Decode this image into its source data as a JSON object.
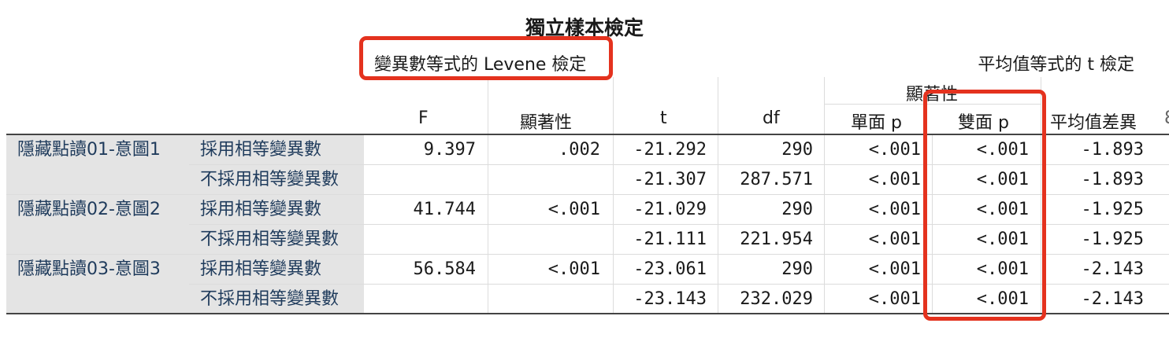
{
  "title": "獨立樣本檢定",
  "levene_header": "變異數等式的 Levene 檢定",
  "ttest_header": "平均值等式的 t 檢定",
  "significance_group": "顯著性",
  "columns": {
    "F": "F",
    "sig": "顯著性",
    "t": "t",
    "df": "df",
    "one_sided_p": "單面 p",
    "two_sided_p": "雙面 p",
    "mean_diff": "平均值差異",
    "cut": "8"
  },
  "groups": [
    {
      "name": "隱藏點讀01-意圖1",
      "rows": [
        {
          "assumption": "採用相等變異數",
          "F": "9.397",
          "sig": ".002",
          "t": "-21.292",
          "df": "290",
          "p1": "<.001",
          "p2": "<.001",
          "md": "-1.893"
        },
        {
          "assumption": "不採用相等變異數",
          "F": "",
          "sig": "",
          "t": "-21.307",
          "df": "287.571",
          "p1": "<.001",
          "p2": "<.001",
          "md": "-1.893"
        }
      ]
    },
    {
      "name": "隱藏點讀02-意圖2",
      "rows": [
        {
          "assumption": "採用相等變異數",
          "F": "41.744",
          "sig": "<.001",
          "t": "-21.029",
          "df": "290",
          "p1": "<.001",
          "p2": "<.001",
          "md": "-1.925"
        },
        {
          "assumption": "不採用相等變異數",
          "F": "",
          "sig": "",
          "t": "-21.111",
          "df": "221.954",
          "p1": "<.001",
          "p2": "<.001",
          "md": "-1.925"
        }
      ]
    },
    {
      "name": "隱藏點讀03-意圖3",
      "rows": [
        {
          "assumption": "採用相等變異數",
          "F": "56.584",
          "sig": "<.001",
          "t": "-23.061",
          "df": "290",
          "p1": "<.001",
          "p2": "<.001",
          "md": "-2.143"
        },
        {
          "assumption": "不採用相等變異數",
          "F": "",
          "sig": "",
          "t": "-23.143",
          "df": "232.029",
          "p1": "<.001",
          "p2": "<.001",
          "md": "-2.143"
        }
      ]
    }
  ],
  "colors": {
    "highlight": "#e4321e",
    "label_bg": "#e4e4e4"
  }
}
